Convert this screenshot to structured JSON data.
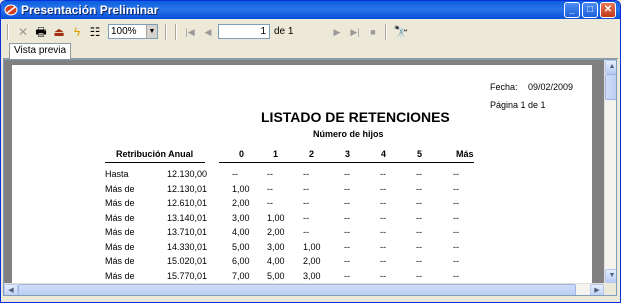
{
  "window": {
    "title": "Presentación Preliminar"
  },
  "toolbar": {
    "zoom": "100%",
    "page": "1",
    "of_label": "de 1"
  },
  "tabs": [
    {
      "label": "Vista previa"
    }
  ],
  "report": {
    "fecha_label": "Fecha:",
    "fecha_value": "09/02/2009",
    "pagina": "Página 1 de 1",
    "title": "LISTADO DE RETENCIONES",
    "subtitle": "Número de hijos",
    "col_retribucion": "Retribución Anual",
    "columns": [
      "0",
      "1",
      "2",
      "3",
      "4",
      "5",
      "Más"
    ],
    "rows": [
      {
        "label": "Hasta",
        "amount": "12.130,00",
        "vals": [
          "--",
          "--",
          "--",
          "--",
          "--",
          "--",
          "--"
        ]
      },
      {
        "label": "Más de",
        "amount": "12.130,01",
        "vals": [
          "1,00",
          "--",
          "--",
          "--",
          "--",
          "--",
          "--"
        ]
      },
      {
        "label": "Más de",
        "amount": "12.610,01",
        "vals": [
          "2,00",
          "--",
          "--",
          "--",
          "--",
          "--",
          "--"
        ]
      },
      {
        "label": "Más de",
        "amount": "13.140,01",
        "vals": [
          "3,00",
          "1,00",
          "--",
          "--",
          "--",
          "--",
          "--"
        ]
      },
      {
        "label": "Más de",
        "amount": "13.710,01",
        "vals": [
          "4,00",
          "2,00",
          "--",
          "--",
          "--",
          "--",
          "--"
        ]
      },
      {
        "label": "Más de",
        "amount": "14.330,01",
        "vals": [
          "5,00",
          "3,00",
          "1,00",
          "--",
          "--",
          "--",
          "--"
        ]
      },
      {
        "label": "Más de",
        "amount": "15.020,01",
        "vals": [
          "6,00",
          "4,00",
          "2,00",
          "--",
          "--",
          "--",
          "--"
        ]
      },
      {
        "label": "Más de",
        "amount": "15.770,01",
        "vals": [
          "7,00",
          "5,00",
          "3,00",
          "--",
          "--",
          "--",
          "--"
        ]
      }
    ]
  }
}
